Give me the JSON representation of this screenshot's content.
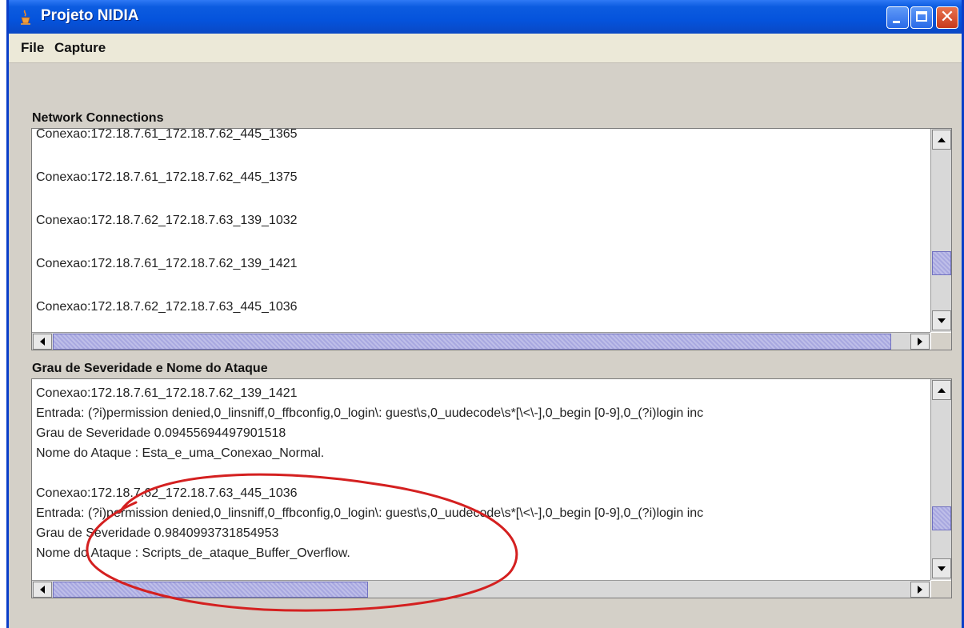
{
  "window": {
    "title": "Projeto NIDIA",
    "controls": {
      "minimize": "minimize",
      "maximize": "maximize",
      "close": "✕"
    }
  },
  "menu": {
    "file": "File",
    "capture": "Capture"
  },
  "network_panel": {
    "title": "Network Connections",
    "items": [
      "Conexao:172.18.7.61_172.18.7.62_445_1365",
      "Conexao:172.18.7.61_172.18.7.62_445_1375",
      "Conexao:172.18.7.62_172.18.7.63_139_1032",
      "Conexao:172.18.7.61_172.18.7.62_139_1421",
      "Conexao:172.18.7.62_172.18.7.63_445_1036"
    ]
  },
  "severity_panel": {
    "title": "Grau de Severidade e Nome do Ataque",
    "lines": [
      "Conexao:172.18.7.61_172.18.7.62_139_1421",
      "Entrada: (?i)permission denied,0_linsniff,0_ffbconfig,0_login\\: guest\\s,0_uudecode\\s*[\\<\\-],0_begin [0-9],0_(?i)login inc",
      "Grau de Severidade 0.09455694497901518",
      "Nome do Ataque : Esta_e_uma_Conexao_Normal.",
      "",
      "Conexao:172.18.7.62_172.18.7.63_445_1036",
      "Entrada: (?i)permission denied,0_linsniff,0_ffbconfig,0_login\\: guest\\s,0_uudecode\\s*[\\<\\-],0_begin [0-9],0_(?i)login inc",
      "Grau de Severidade 0.9840993731854953",
      "Nome do Ataque : Scripts_de_ataque_Buffer_Overflow."
    ]
  },
  "colors": {
    "title_bar": "#0553dc",
    "scroll_thumb": "#a8a8e0",
    "annotation_ellipse": "#d42020"
  }
}
